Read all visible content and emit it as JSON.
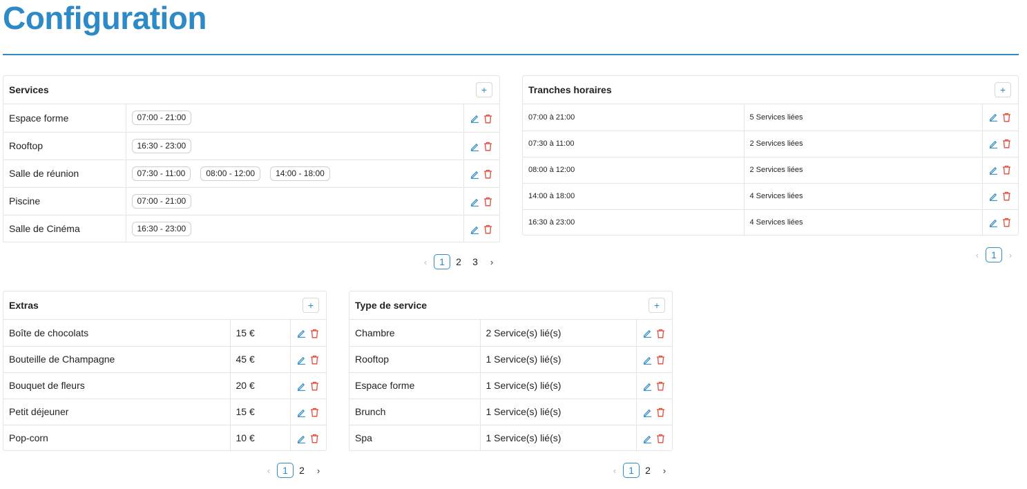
{
  "page": {
    "title": "Configuration"
  },
  "icons": {
    "edit": "pencil-icon",
    "delete": "trash-icon",
    "add": "plus-icon"
  },
  "colors": {
    "accent": "#2d8ac7",
    "danger": "#e04b3a"
  },
  "services": {
    "title": "Services",
    "add_label": "+",
    "rows": [
      {
        "name": "Espace forme",
        "slots": [
          "07:00 - 21:00"
        ]
      },
      {
        "name": "Rooftop",
        "slots": [
          "16:30 - 23:00"
        ]
      },
      {
        "name": "Salle de réunion",
        "slots": [
          "07:30 - 11:00",
          "08:00 - 12:00",
          "14:00 - 18:00"
        ]
      },
      {
        "name": "Piscine",
        "slots": [
          "07:00 - 21:00"
        ]
      },
      {
        "name": "Salle de Cinéma",
        "slots": [
          "16:30 - 23:00"
        ]
      }
    ],
    "pagination": {
      "prev": "‹",
      "current": "1",
      "pages": [
        "2",
        "3"
      ],
      "next": "›"
    }
  },
  "tranches": {
    "title": "Tranches horaires",
    "add_label": "+",
    "rows": [
      {
        "range": "07:00 à 21:00",
        "linked": "5 Services liées"
      },
      {
        "range": "07:30 à 11:00",
        "linked": "2 Services liées"
      },
      {
        "range": "08:00 à 12:00",
        "linked": "2 Services liées"
      },
      {
        "range": "14:00 à 18:00",
        "linked": "4 Services liées"
      },
      {
        "range": "16:30 à 23:00",
        "linked": "4 Services liées"
      }
    ],
    "pagination": {
      "prev": "‹",
      "current": "1",
      "pages": [],
      "next": "›"
    }
  },
  "extras": {
    "title": "Extras",
    "add_label": "+",
    "rows": [
      {
        "name": "Boîte de chocolats",
        "price": "15 €"
      },
      {
        "name": "Bouteille de Champagne",
        "price": "45 €"
      },
      {
        "name": "Bouquet de fleurs",
        "price": "20 €"
      },
      {
        "name": "Petit déjeuner",
        "price": "15 €"
      },
      {
        "name": "Pop-corn",
        "price": "10 €"
      }
    ],
    "pagination": {
      "prev": "‹",
      "current": "1",
      "pages": [
        "2"
      ],
      "next": "›"
    }
  },
  "types": {
    "title": "Type de service",
    "add_label": "+",
    "rows": [
      {
        "name": "Chambre",
        "linked": "2 Service(s) lié(s)"
      },
      {
        "name": "Rooftop",
        "linked": "1 Service(s) lié(s)"
      },
      {
        "name": "Espace forme",
        "linked": "1 Service(s) lié(s)"
      },
      {
        "name": "Brunch",
        "linked": "1 Service(s) lié(s)"
      },
      {
        "name": "Spa",
        "linked": "1 Service(s) lié(s)"
      }
    ],
    "pagination": {
      "prev": "‹",
      "current": "1",
      "pages": [
        "2"
      ],
      "next": "›"
    }
  }
}
